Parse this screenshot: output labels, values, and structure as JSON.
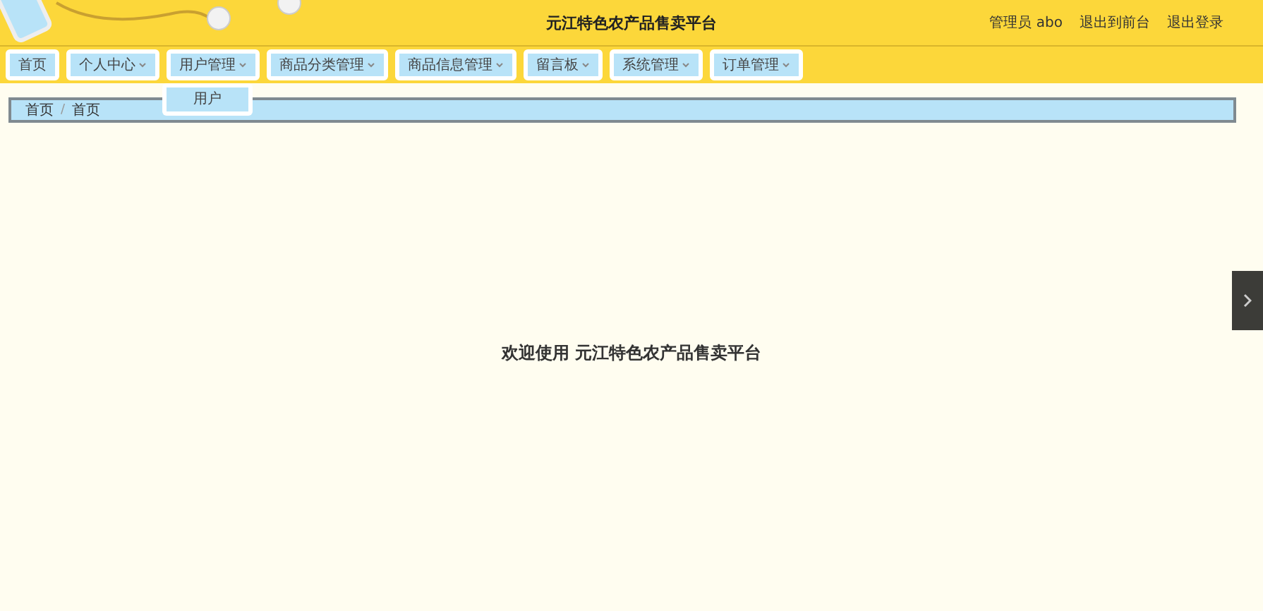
{
  "header": {
    "title": "元江特色农产品售卖平台",
    "user": "管理员 abo",
    "links": [
      "退出到前台",
      "退出登录"
    ]
  },
  "nav": [
    {
      "label": "首页",
      "kind": "link"
    },
    {
      "label": "个人中心",
      "kind": "menu"
    },
    {
      "label": "用户管理",
      "kind": "menu",
      "children": [
        "用户"
      ]
    },
    {
      "label": "商品分类管理",
      "kind": "menu"
    },
    {
      "label": "商品信息管理",
      "kind": "menu"
    },
    {
      "label": "留言板",
      "kind": "menu"
    },
    {
      "label": "系统管理",
      "kind": "menu"
    },
    {
      "label": "订单管理",
      "kind": "menu"
    }
  ],
  "breadcrumb": {
    "items": [
      "首页",
      "首页"
    ],
    "separator": "/"
  },
  "welcome": "欢迎使用 元江特色农产品售卖平台"
}
